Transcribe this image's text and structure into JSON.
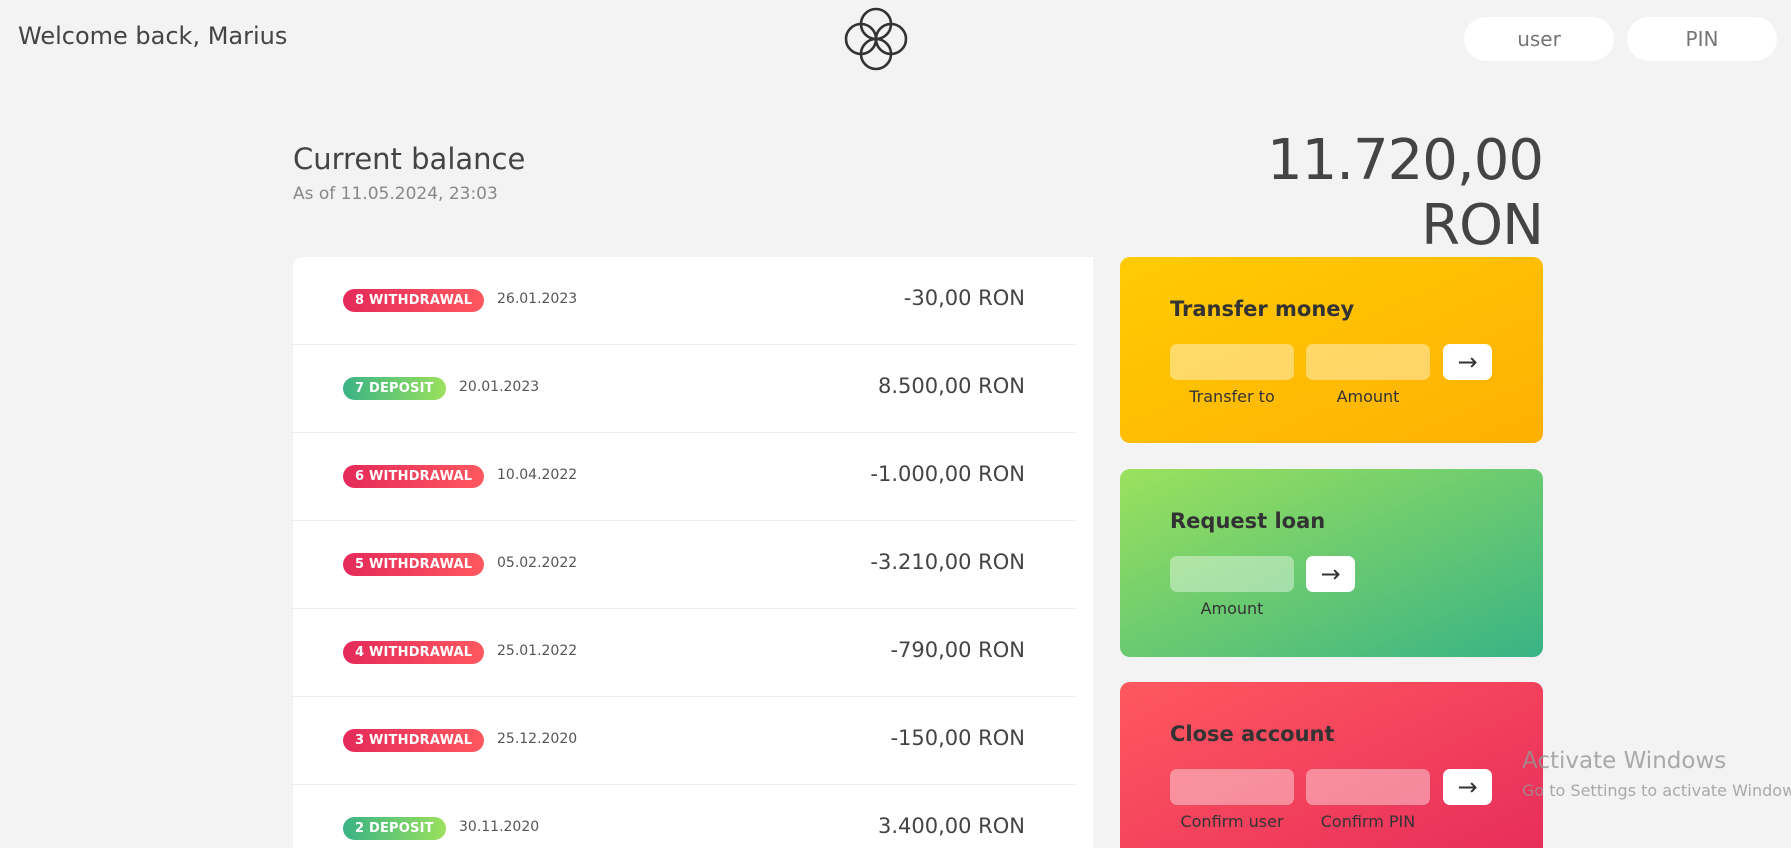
{
  "header": {
    "welcome": "Welcome back, Marius",
    "login_user_placeholder": "user",
    "login_pin_placeholder": "PIN"
  },
  "balance": {
    "title": "Current balance",
    "date_text": "As of 11.05.2024, 23:03",
    "value": "11.720,00 RON"
  },
  "movements": [
    {
      "label": "8 WITHDRAWAL",
      "type": "withdrawal",
      "date": "26.01.2023",
      "amount": "-30,00 RON"
    },
    {
      "label": "7 DEPOSIT",
      "type": "deposit",
      "date": "20.01.2023",
      "amount": "8.500,00 RON"
    },
    {
      "label": "6 WITHDRAWAL",
      "type": "withdrawal",
      "date": "10.04.2022",
      "amount": "-1.000,00 RON"
    },
    {
      "label": "5 WITHDRAWAL",
      "type": "withdrawal",
      "date": "05.02.2022",
      "amount": "-3.210,00 RON"
    },
    {
      "label": "4 WITHDRAWAL",
      "type": "withdrawal",
      "date": "25.01.2022",
      "amount": "-790,00 RON"
    },
    {
      "label": "3 WITHDRAWAL",
      "type": "withdrawal",
      "date": "25.12.2020",
      "amount": "-150,00 RON"
    },
    {
      "label": "2 DEPOSIT",
      "type": "deposit",
      "date": "30.11.2020",
      "amount": "3.400,00 RON"
    }
  ],
  "operations": {
    "transfer": {
      "title": "Transfer money",
      "label_to": "Transfer to",
      "label_amount": "Amount",
      "button": "→"
    },
    "loan": {
      "title": "Request loan",
      "label_amount": "Amount",
      "button": "→"
    },
    "close": {
      "title": "Close account",
      "label_user": "Confirm user",
      "label_pin": "Confirm PIN",
      "button": "→"
    }
  },
  "watermark": {
    "title": "Activate Windows",
    "subtitle": "Go to Settings to activate Windows."
  },
  "colors": {
    "withdrawal": "#e52a5a",
    "deposit": "#39b385",
    "transfer": "#ffb003",
    "loan": "#39b385",
    "close": "#e52a5a"
  },
  "icons": {
    "logo": "four-circles-logo-icon",
    "arrow": "right-arrow-icon"
  }
}
